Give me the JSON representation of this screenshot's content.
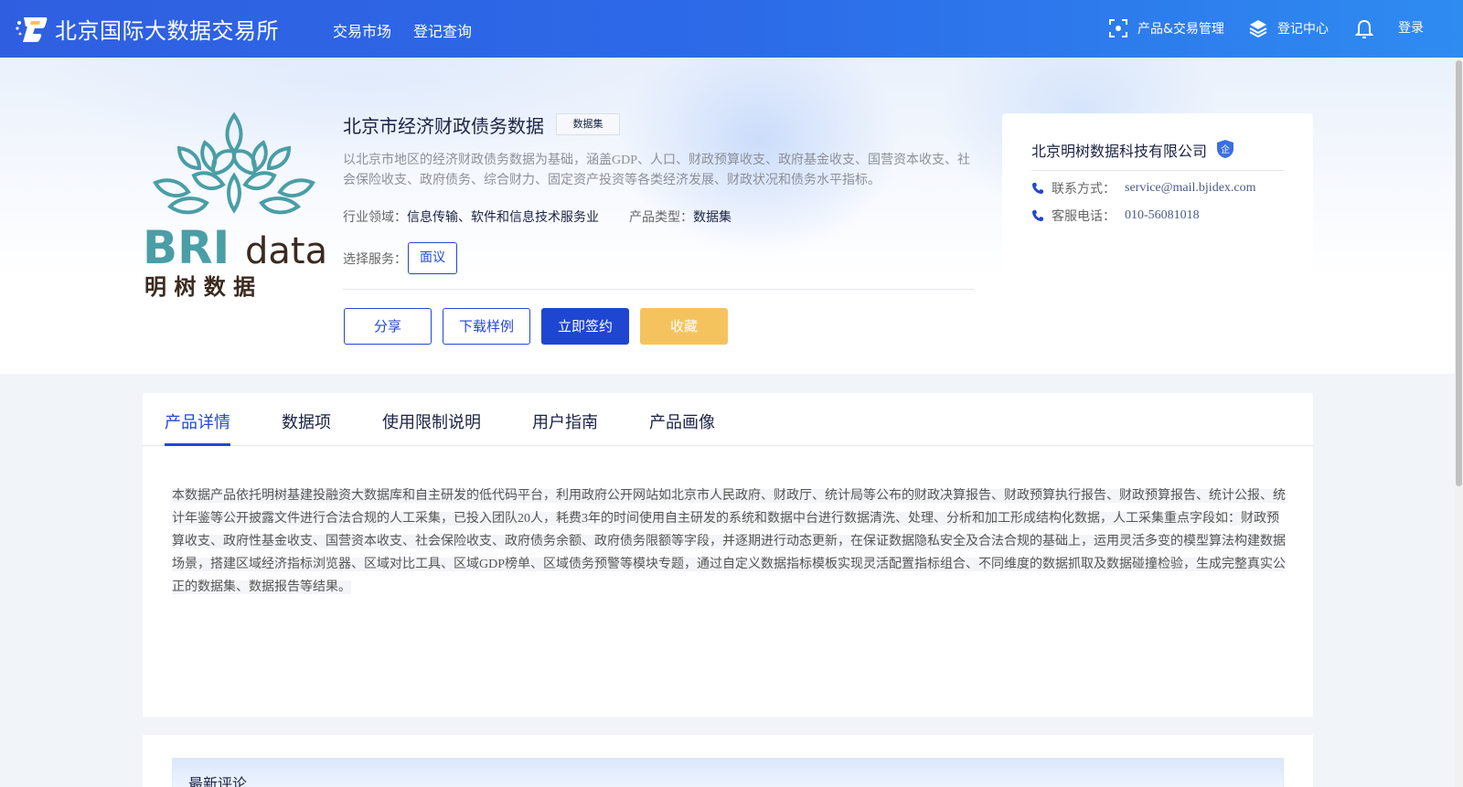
{
  "header": {
    "brand": "北京国际大数据交易所",
    "nav": [
      "交易市场",
      "登记查询"
    ],
    "right": {
      "product_mgmt": "产品&交易管理",
      "reg_center": "登记中心",
      "login": "登录"
    },
    "colors": {
      "bar_start": "#2f5fe0",
      "bar_end": "#2e8bf0"
    }
  },
  "product": {
    "logo": {
      "text_main": "BRI",
      "text_sub": "data",
      "text_cn": "明 树 数 据"
    },
    "title": "北京市经济财政债务数据",
    "tag": "数据集",
    "description": "以北京市地区的经济财政债务数据为基础，涵盖GDP、人口、财政预算收支、政府基金收支、国营资本收支、社会保险收支、政府债务、综合财力、固定资产投资等各类经济发展、财政状况和债务水平指标。",
    "industry_label": "行业领域：",
    "industry_value": "信息传输、软件和信息技术服务业",
    "type_label": "产品类型：",
    "type_value": "数据集",
    "service_label": "选择服务：",
    "service_option": "面议",
    "actions": {
      "share": "分享",
      "download": "下载样例",
      "sign": "立即签约",
      "favorite": "收藏"
    }
  },
  "vendor": {
    "name": "北京明树数据科技有限公司",
    "badge": "企",
    "contact_label": "联系方式：",
    "contact_value": "service@mail.bjidex.com",
    "phone_label": "客服电话：",
    "phone_value": "010-56081018"
  },
  "tabs": [
    "产品详情",
    "数据项",
    "使用限制说明",
    "用户指南",
    "产品画像"
  ],
  "active_tab": "产品详情",
  "detail_text": "本数据产品依托明树基建投融资大数据库和自主研发的低代码平台，利用政府公开网站如北京市人民政府、财政厅、统计局等公布的财政决算报告、财政预算执行报告、财政预算报告、统计公报、统计年鉴等公开披露文件进行合法合规的人工采集，已投入团队20人，耗费3年的时间使用自主研发的系统和数据中台进行数据清洗、处理、分析和加工形成结构化数据，人工采集重点字段如：财政预算收支、政府性基金收支、国营资本收支、社会保险收支、政府债务余额、政府债务限额等字段，并逐期进行动态更新，在保证数据隐私安全及合法合规的基础上，运用灵活多变的模型算法构建数据场景，搭建区域经济指标浏览器、区域对比工具、区域GDP榜单、区域债务预警等模块专题，通过自定义数据指标模板实现灵活配置指标组合、不同维度的数据抓取及数据碰撞检验，生成完整真实公正的数据集、数据报告等结果。",
  "comments": {
    "title": "最新评论"
  }
}
